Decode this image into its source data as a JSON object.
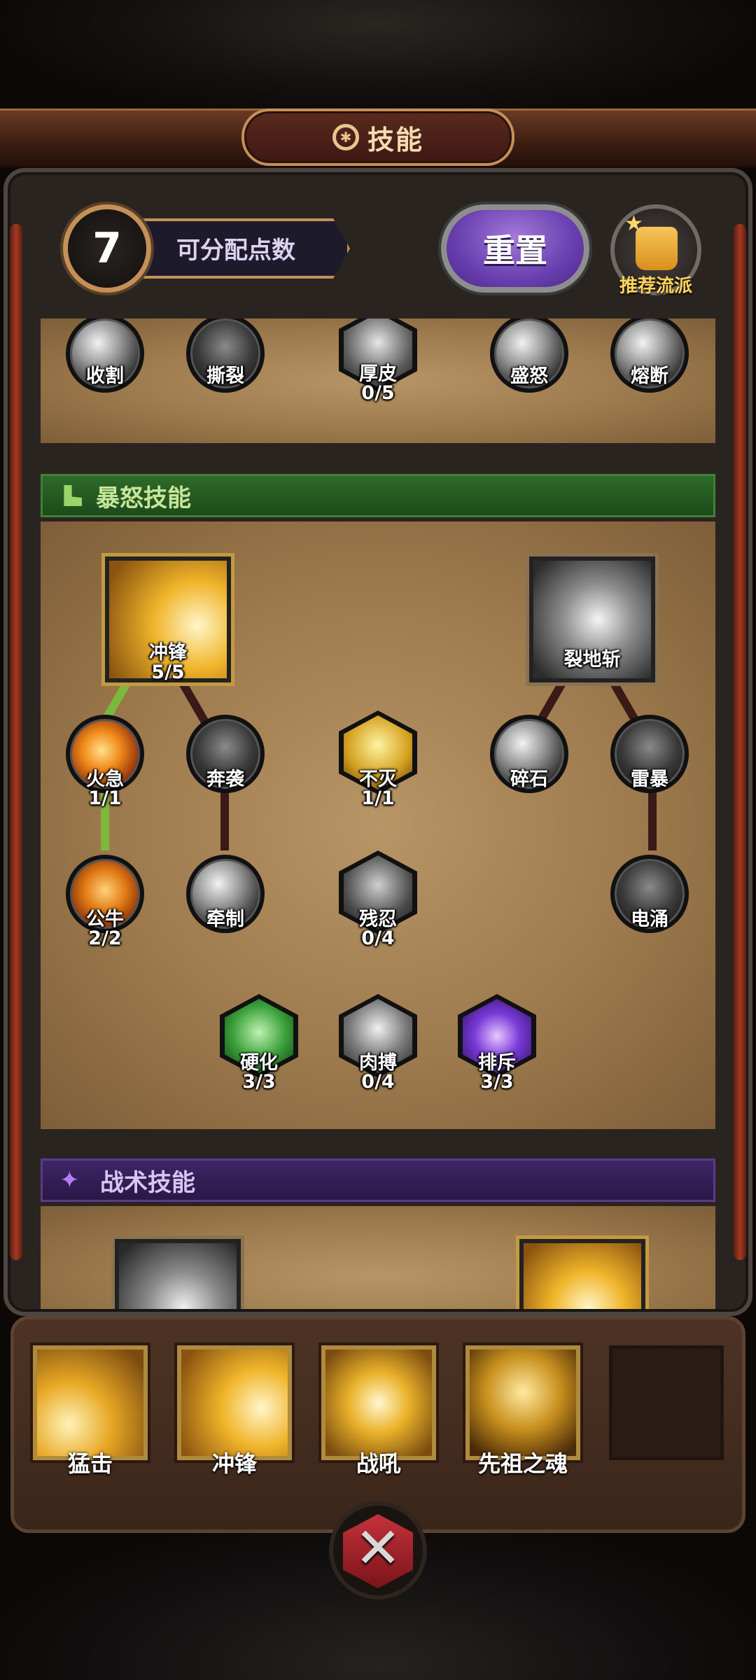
{
  "header": {
    "title": "技能"
  },
  "points": {
    "available": "7",
    "label": "可分配点数"
  },
  "buttons": {
    "reset": "重置",
    "recommend": "推荐流派"
  },
  "top_row": [
    {
      "name": "收割",
      "level": ""
    },
    {
      "name": "撕裂",
      "level": ""
    },
    {
      "name": "厚皮",
      "level": "0/5"
    },
    {
      "name": "盛怒",
      "level": ""
    },
    {
      "name": "熔断",
      "level": ""
    }
  ],
  "rage_section": {
    "title": "暴怒技能",
    "nodes": [
      {
        "name": "冲锋",
        "level": "5/5"
      },
      {
        "name": "裂地斩",
        "level": ""
      },
      {
        "name": "火急",
        "level": "1/1"
      },
      {
        "name": "奔袭",
        "level": ""
      },
      {
        "name": "不灭",
        "level": "1/1"
      },
      {
        "name": "碎石",
        "level": ""
      },
      {
        "name": "雷暴",
        "level": ""
      },
      {
        "name": "公牛",
        "level": "2/2"
      },
      {
        "name": "牵制",
        "level": ""
      },
      {
        "name": "残忍",
        "level": "0/4"
      },
      {
        "name": "电涌",
        "level": ""
      },
      {
        "name": "硬化",
        "level": "3/3"
      },
      {
        "name": "肉搏",
        "level": "0/4"
      },
      {
        "name": "排斥",
        "level": "3/3"
      }
    ]
  },
  "tactic_section": {
    "title": "战术技能"
  },
  "skill_bar": [
    {
      "name": "猛击"
    },
    {
      "name": "冲锋"
    },
    {
      "name": "战吼"
    },
    {
      "name": "先祖之魂"
    }
  ],
  "colors": {
    "gold": "#c49058",
    "rage_green": "#2e6a2a",
    "tactic_purple": "#3e2566",
    "reset_purple": "#6a3fb0"
  }
}
